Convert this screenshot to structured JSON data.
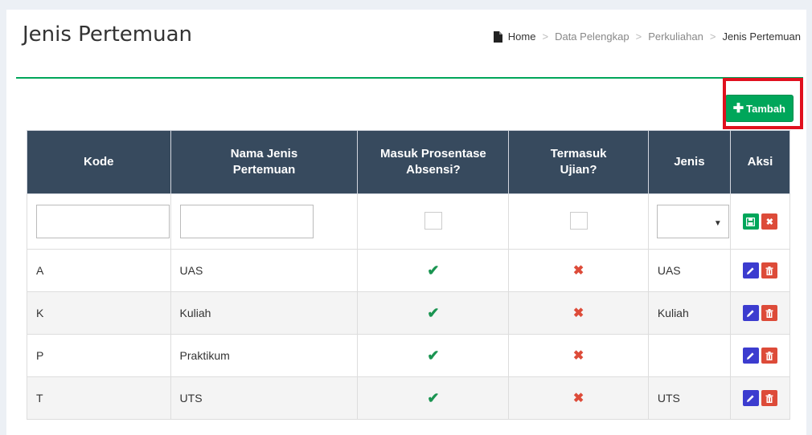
{
  "header": {
    "title": "Jenis Pertemuan"
  },
  "breadcrumb": {
    "home": "Home",
    "sep": ">",
    "items": [
      "Data Pelengkap",
      "Perkuliahan",
      "Jenis Pertemuan"
    ]
  },
  "toolbar": {
    "add_label": "Tambah"
  },
  "table": {
    "columns": [
      "Kode",
      "Nama Jenis Pertemuan",
      "Masuk Prosentase Absensi?",
      "Termasuk Ujian?",
      "Jenis",
      "Aksi"
    ],
    "rows": [
      {
        "kode": "A",
        "nama": "UAS",
        "absensi": true,
        "ujian": false,
        "jenis": "UAS"
      },
      {
        "kode": "K",
        "nama": "Kuliah",
        "absensi": true,
        "ujian": false,
        "jenis": "Kuliah"
      },
      {
        "kode": "P",
        "nama": "Praktikum",
        "absensi": true,
        "ujian": false,
        "jenis": ""
      },
      {
        "kode": "T",
        "nama": "UTS",
        "absensi": true,
        "ujian": false,
        "jenis": "UTS"
      }
    ]
  },
  "icons": {
    "check": "✔",
    "cross": "✖",
    "save": "save-icon",
    "clear": "close-icon",
    "edit": "pencil-icon",
    "delete": "trash-icon"
  },
  "colors": {
    "accent": "#00a65a",
    "header_bg": "#374a5e",
    "danger": "#dd4b39",
    "edit": "#3c3ccf",
    "highlight": "#e0101e"
  }
}
